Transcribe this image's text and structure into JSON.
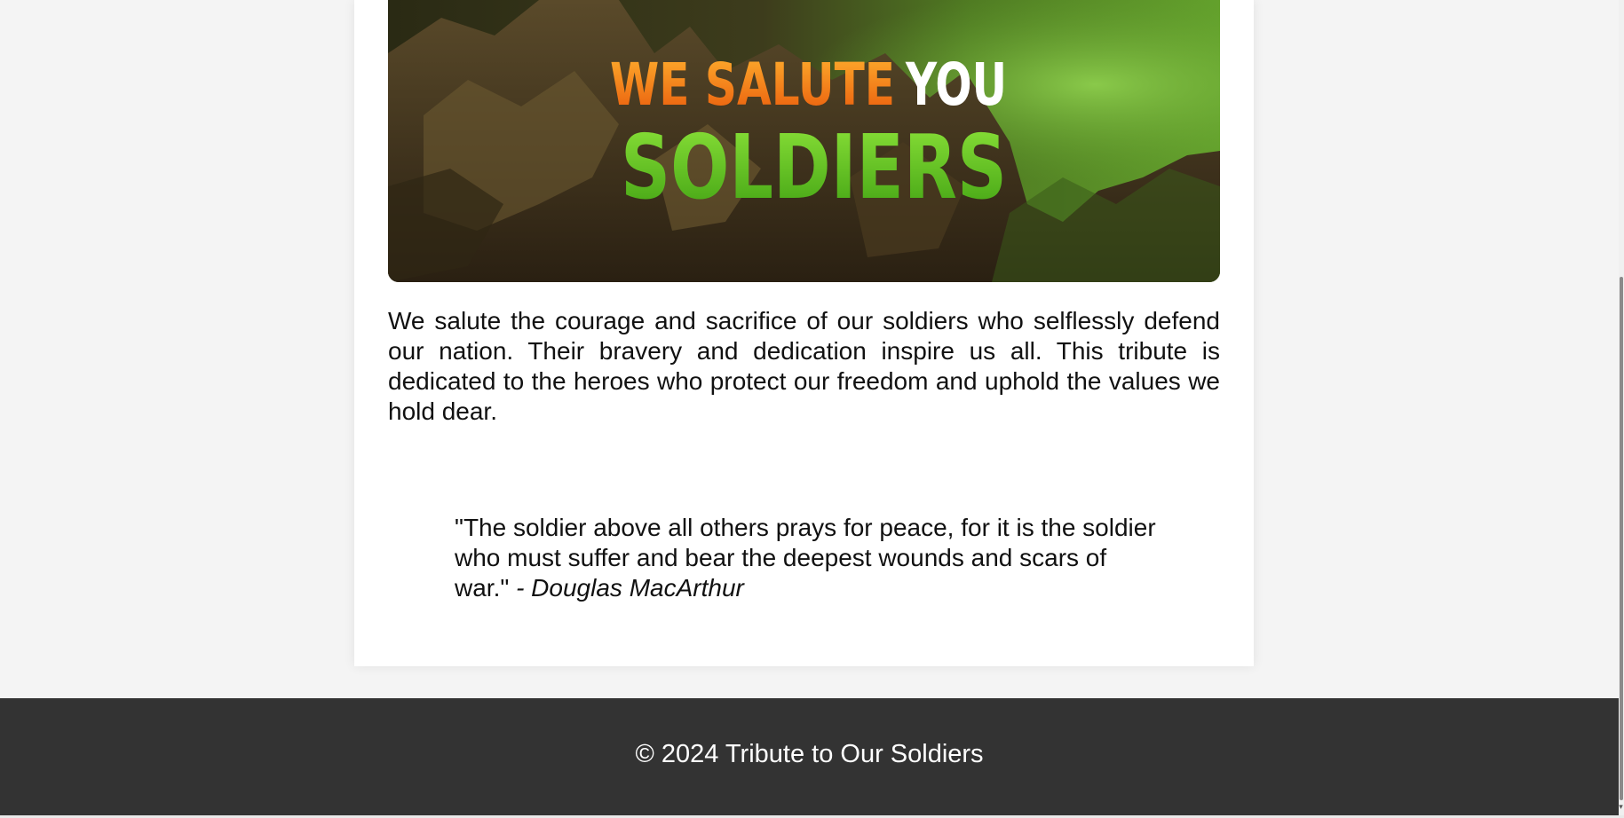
{
  "hero": {
    "line1_orange": "WE SALUTE",
    "line1_white": "YOU",
    "line2_green": "SOLDIERS",
    "colors": {
      "orange": "#f47b12",
      "white": "#ffffff",
      "green": "#6fd11c"
    }
  },
  "intro": {
    "text": "We salute the courage and sacrifice of our soldiers who selflessly defend our nation. Their bravery and dedication inspire us all. This tribute is dedicated to the heroes who protect our freedom and uphold the values we hold dear."
  },
  "quote": {
    "text": "\"The soldier above all others prays for peace, for it is the soldier who must suffer and bear the deepest wounds and scars of war.\"",
    "author": " - Douglas MacArthur"
  },
  "footer": {
    "text": "© 2024 Tribute to Our Soldiers"
  },
  "scrollbar": {
    "arrow_icon": "chevron-down-icon"
  }
}
